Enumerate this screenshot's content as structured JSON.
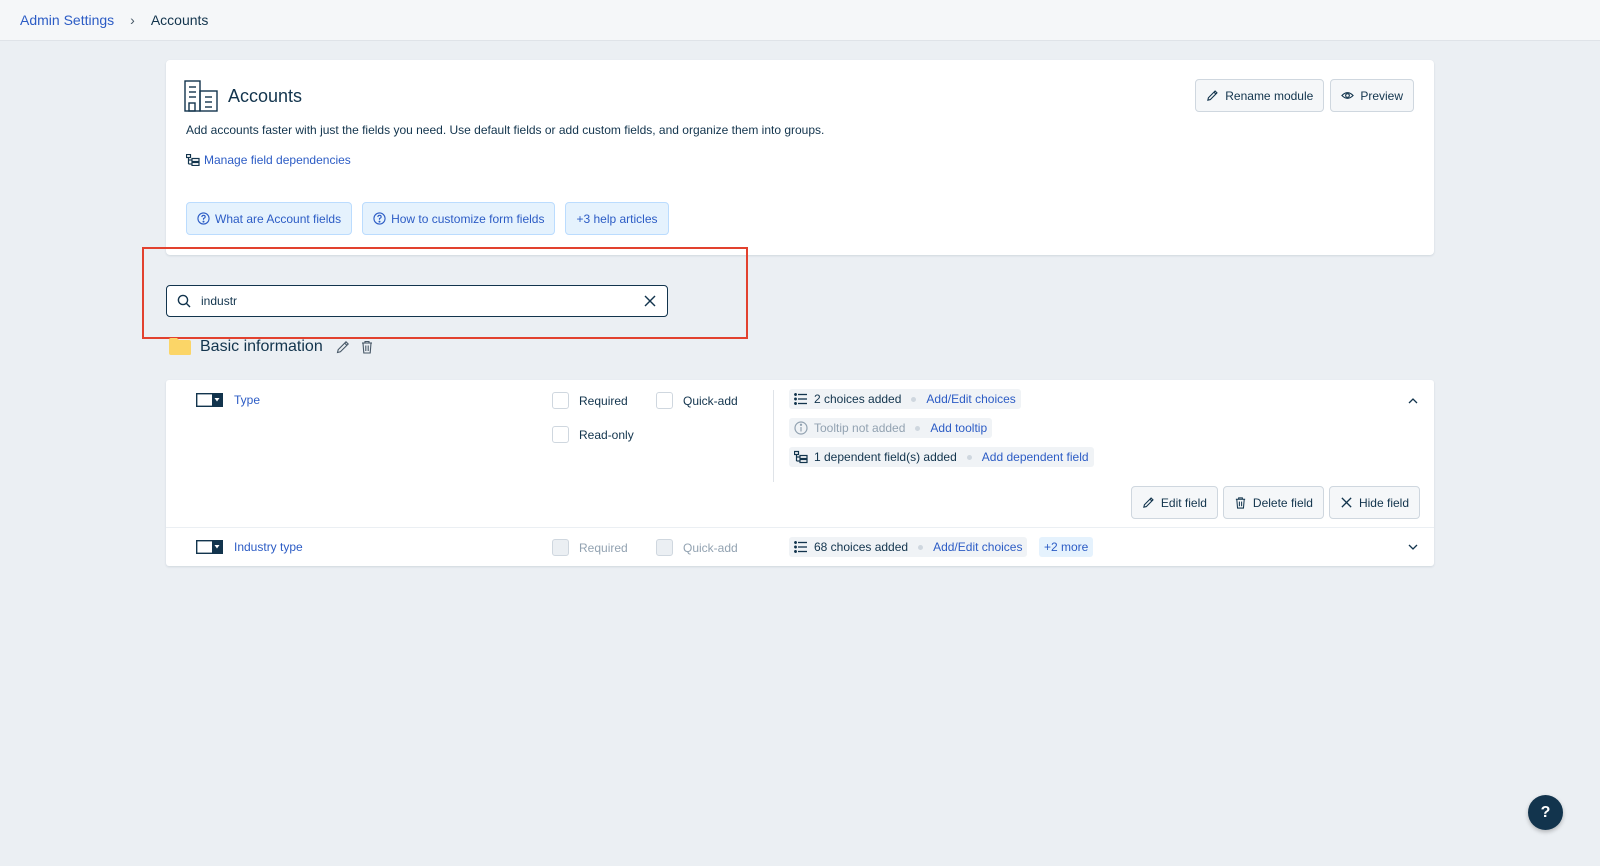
{
  "breadcrumb": {
    "parent": "Admin Settings",
    "separator": "›",
    "current": "Accounts"
  },
  "module": {
    "title": "Accounts",
    "description": "Add accounts faster with just the fields you need. Use default fields or add custom fields, and organize them into groups.",
    "dependencies_link": "Manage field dependencies",
    "rename_label": "Rename module",
    "preview_label": "Preview",
    "help_articles": [
      "What are Account fields",
      "How to customize form fields",
      "+3 help articles"
    ]
  },
  "search": {
    "value": "industr",
    "placeholder": ""
  },
  "group": {
    "title": "Basic information"
  },
  "fields": [
    {
      "name": "Type",
      "required_label": "Required",
      "quickadd_label": "Quick-add",
      "readonly_label": "Read-only",
      "choices_text": "2 choices added",
      "choices_link": "Add/Edit choices",
      "tooltip_text": "Tooltip not added",
      "tooltip_link": "Add tooltip",
      "dependent_text": "1 dependent field(s) added",
      "dependent_link": "Add dependent field",
      "actions": {
        "edit": "Edit field",
        "delete": "Delete field",
        "hide": "Hide field"
      }
    },
    {
      "name": "Industry type",
      "required_label": "Required",
      "quickadd_label": "Quick-add",
      "choices_text": "68 choices added",
      "choices_link": "Add/Edit choices",
      "more_label": "+2 more"
    }
  ],
  "help_fab": {
    "label": "?"
  },
  "colors": {
    "accent": "#2c5cc5",
    "text": "#12344d",
    "highlight": "#e2412e",
    "background": "#ebeff3"
  }
}
